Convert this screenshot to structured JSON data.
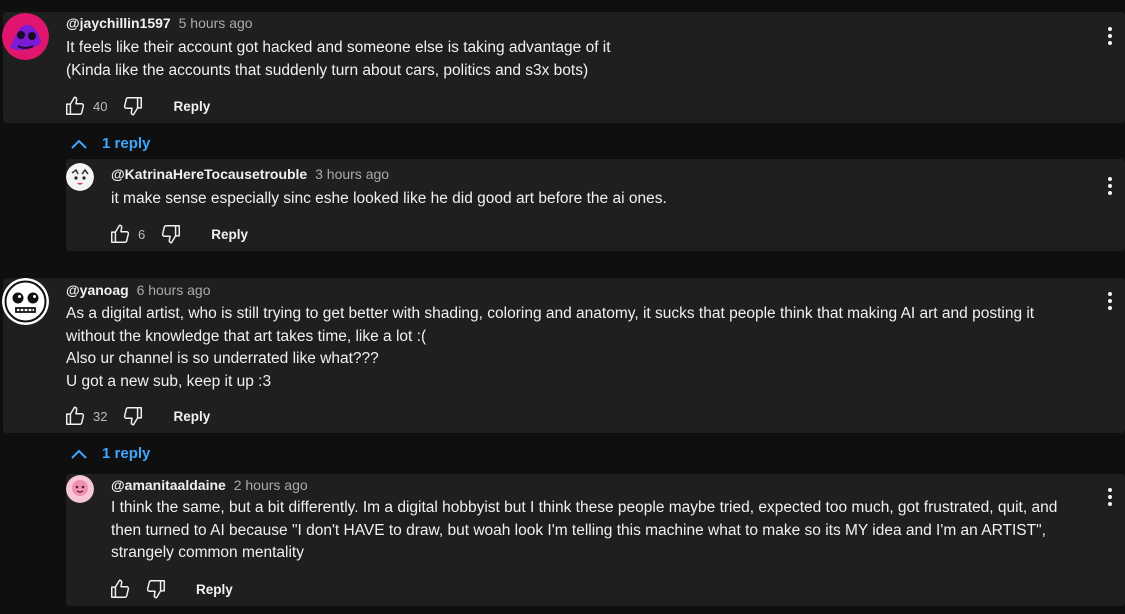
{
  "comments": [
    {
      "handle": "@jaychillin1597",
      "time": "5 hours ago",
      "lines": [
        "It feels like their account got hacked and someone else is taking advantage of it",
        "(Kinda like the accounts that suddenly turn about cars, politics and s3x bots)"
      ],
      "likes": "40",
      "reply_label": "Reply",
      "replies_toggle": "1 reply",
      "reply": {
        "handle": "@KatrinaHereTocausetrouble",
        "time": "3 hours ago",
        "lines": [
          "it make sense especially sinc eshe looked like he did good art before the ai ones."
        ],
        "likes": "6",
        "reply_label": "Reply"
      }
    },
    {
      "handle": "@yanoag",
      "time": "6 hours ago",
      "lines": [
        "As a digital artist, who is still trying to get better with shading, coloring and anatomy, it sucks that people think that making AI art and posting it",
        "without the knowledge that art takes time, like a lot :(",
        "Also ur channel is so underrated like what???",
        "U got a new sub, keep it up :3"
      ],
      "likes": "32",
      "reply_label": "Reply",
      "replies_toggle": "1 reply",
      "reply": {
        "handle": "@amanitaaldaine",
        "time": "2 hours ago",
        "lines": [
          "I think the same, but a bit differently. Im a digital hobbyist but I think these people maybe tried, expected too much, got frustrated, quit, and",
          "then turned to AI because \"I don't HAVE to draw, but woah look I'm telling this machine what to make so its MY idea and I'm an ARTIST\",",
          "strangely common mentality"
        ],
        "likes": "",
        "reply_label": "Reply"
      }
    }
  ],
  "icons": {
    "like": "thumbs-up-icon",
    "dislike": "thumbs-down-icon",
    "menu": "more-vertical-icon",
    "collapse": "chevron-up-icon"
  },
  "colors": {
    "background": "#0f0f0f",
    "card": "#1f1f1f",
    "link": "#3ea6ff",
    "secondary_text": "#aaaaaa"
  }
}
